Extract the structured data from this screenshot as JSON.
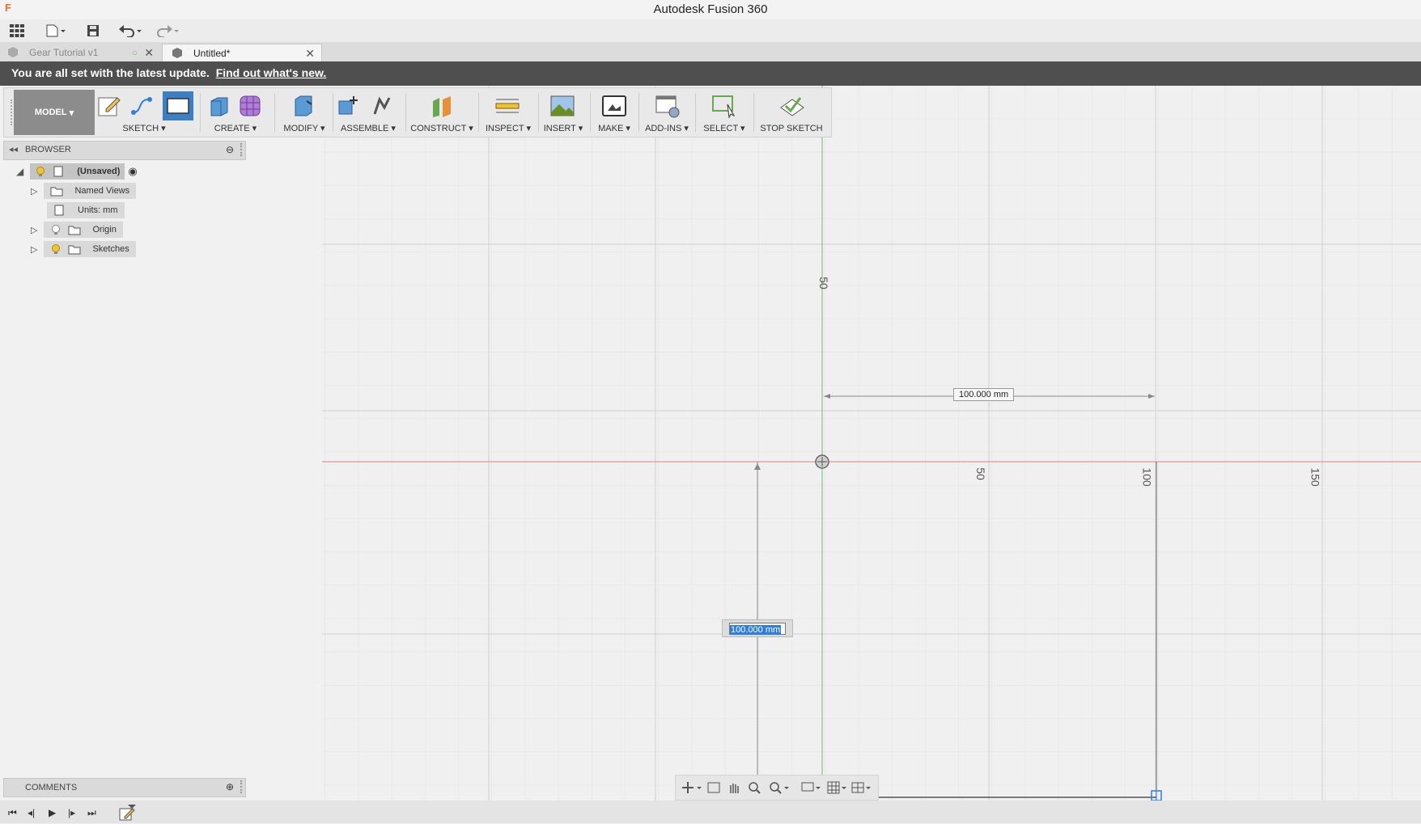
{
  "app": {
    "title": "Autodesk Fusion 360",
    "logo": "F"
  },
  "tabs": [
    {
      "label": "Gear Tutorial v1",
      "active": false
    },
    {
      "label": "Untitled*",
      "active": true
    }
  ],
  "banner": {
    "text": "You are all set with the latest update.",
    "link": "Find out what's new."
  },
  "toolbar": {
    "workspace": "MODEL",
    "groups": [
      "SKETCH",
      "CREATE",
      "MODIFY",
      "ASSEMBLE",
      "CONSTRUCT",
      "INSPECT",
      "INSERT",
      "MAKE",
      "ADD-INS",
      "SELECT",
      "STOP SKETCH"
    ]
  },
  "browser": {
    "title": "BROWSER",
    "root": "(Unsaved)",
    "items": [
      {
        "label": "Named Views"
      },
      {
        "label": "Units: mm"
      },
      {
        "label": "Origin"
      },
      {
        "label": "Sketches"
      }
    ]
  },
  "comments": {
    "title": "COMMENTS"
  },
  "canvas": {
    "axis_labels": {
      "x50": "50",
      "x100": "100",
      "x150": "150",
      "y50": "50",
      "y100": "100"
    },
    "dim_horizontal": "100.000 mm",
    "dim_vertical_input": "100.000 mm",
    "colors": {
      "x_axis": "#e05050",
      "y_axis": "#50b050",
      "selection": "#2e7de1"
    }
  }
}
